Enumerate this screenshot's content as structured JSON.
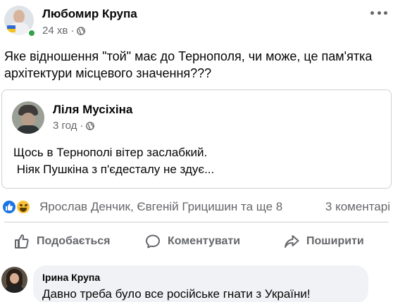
{
  "post": {
    "author": "Любомир Крупа",
    "time": "24 хв",
    "privacy_icon": "globe-icon",
    "text": "Яке відношення \"той\" має до Тернополя, чи може, це пам'ятка архітектури місцевого значення???"
  },
  "shared_post": {
    "author": "Ліля Мусіхіна",
    "time": "3 год",
    "privacy_icon": "globe-icon",
    "lines": [
      "Щось в Тернополі вітер заслабкий.",
      " Ніяк Пушкіна з п'єдесталу не здує..."
    ]
  },
  "reactions": {
    "icons": [
      "like-reaction-icon",
      "haha-reaction-icon"
    ],
    "summary": "Ярослав Денчик, Євгеній Грицишин та ще 8",
    "comments": "3 коментарі"
  },
  "actions": {
    "like": "Подобається",
    "comment": "Коментувати",
    "share": "Поширити"
  },
  "comment": {
    "author": "Ірина Крупа",
    "text": "Давно треба було все російське гнати з України!"
  },
  "colors": {
    "text": "#050505",
    "secondary_text": "#65676b",
    "like_blue": "#1b74e4",
    "online_green": "#31a24c",
    "bubble_bg": "#f0f2f5",
    "border": "#ced0d4"
  }
}
